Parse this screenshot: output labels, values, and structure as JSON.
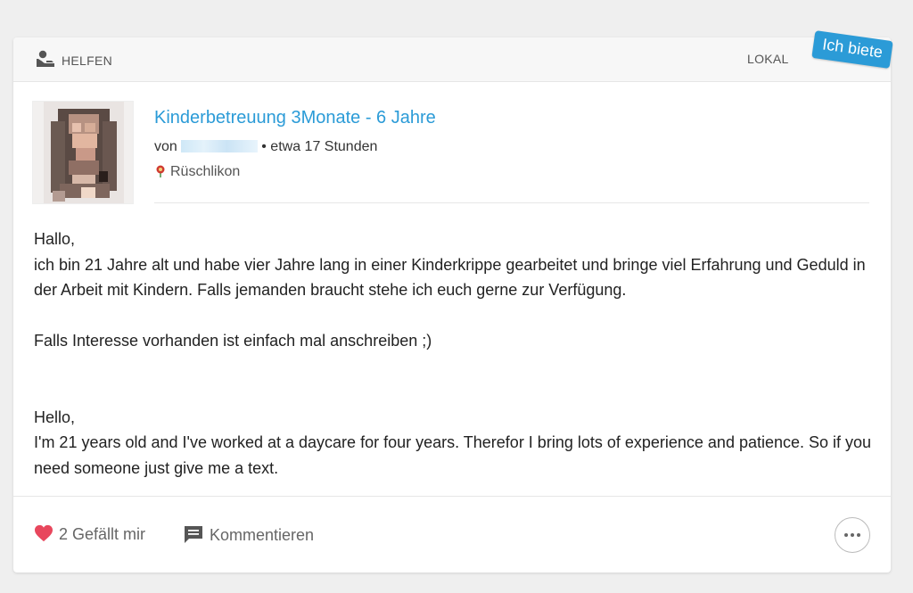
{
  "post": {
    "category": "HELFEN",
    "scope": "LOKAL",
    "badge": "Ich biete",
    "title": "Kinderbetreuung 3Monate - 6 Jahre",
    "by_prefix": "von",
    "time": "• etwa 17 Stunden",
    "location": "Rüschlikon",
    "body": {
      "p1": "Hallo,",
      "p2": "ich bin 21 Jahre alt und habe vier Jahre lang in einer Kinderkrippe gearbeitet und bringe viel Erfahrung und Geduld in der Arbeit mit Kindern. Falls jemanden braucht stehe ich euch gerne zur Verfügung.",
      "p3": "Falls Interesse vorhanden ist einfach mal anschreiben ;)",
      "p4": "Hello,",
      "p5": "I'm 21 years old and I've worked at a daycare for four years. Therefor I bring lots of experience and patience. So if you need someone just give me a text."
    }
  },
  "actions": {
    "like_label": "2 Gefällt mir",
    "comment_label": "Kommentieren"
  },
  "icons": {
    "category": "helping-hand-person-icon",
    "location": "location-flag-icon",
    "like": "heart-icon",
    "comment": "comment-icon",
    "more": "more-options-icon"
  },
  "colors": {
    "accent": "#2b9bd7",
    "heart": "#e8475d",
    "background": "#efefef"
  }
}
